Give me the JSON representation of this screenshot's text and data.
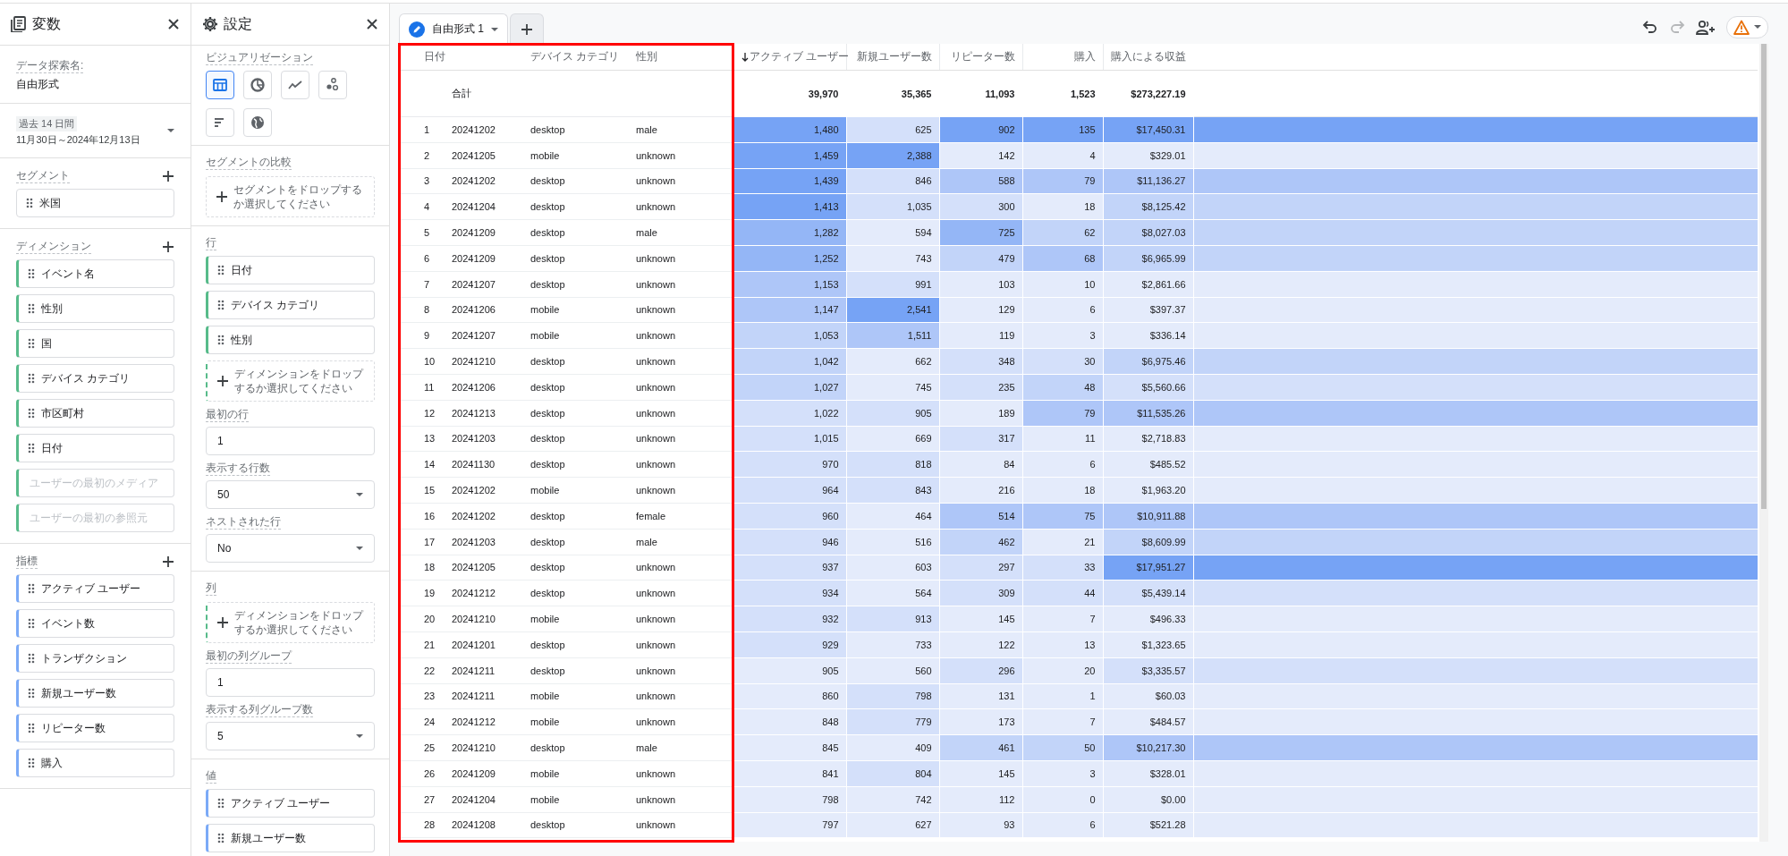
{
  "variables_panel": {
    "title": "変数",
    "exploration_label": "データ探索名:",
    "exploration_name": "自由形式",
    "date_range": {
      "badge": "過去 14 日間",
      "range": "11月30日～2024年12月13日"
    },
    "segments": {
      "label": "セグメント",
      "items": [
        {
          "label": "米国",
          "disabled": false
        }
      ]
    },
    "dimensions": {
      "label": "ディメンション",
      "items": [
        {
          "label": "イベント名",
          "disabled": false
        },
        {
          "label": "性別",
          "disabled": false
        },
        {
          "label": "国",
          "disabled": false
        },
        {
          "label": "デバイス カテゴリ",
          "disabled": false
        },
        {
          "label": "市区町村",
          "disabled": false
        },
        {
          "label": "日付",
          "disabled": false
        },
        {
          "label": "ユーザーの最初のメディア",
          "disabled": true
        },
        {
          "label": "ユーザーの最初の参照元",
          "disabled": true
        }
      ]
    },
    "metrics": {
      "label": "指標",
      "items": [
        {
          "label": "アクティブ ユーザー",
          "disabled": false
        },
        {
          "label": "イベント数",
          "disabled": false
        },
        {
          "label": "トランザクション",
          "disabled": false
        },
        {
          "label": "新規ユーザー数",
          "disabled": false
        },
        {
          "label": "リピーター数",
          "disabled": false
        },
        {
          "label": "購入",
          "disabled": false
        }
      ]
    }
  },
  "settings_panel": {
    "title": "設定",
    "visualization_label": "ビジュアリゼーション",
    "visualizations": [
      {
        "kind": "table",
        "selected": true
      },
      {
        "kind": "donut",
        "selected": false
      },
      {
        "kind": "line",
        "selected": false
      },
      {
        "kind": "scatter",
        "selected": false
      },
      {
        "kind": "bar",
        "selected": false
      },
      {
        "kind": "map",
        "selected": false
      }
    ],
    "segment_compare": {
      "label": "セグメントの比較",
      "drop_hint": "セグメントをドロップするか選択してください"
    },
    "rows": {
      "label": "行",
      "items": [
        {
          "label": "日付",
          "disabled": false
        },
        {
          "label": "デバイス カテゴリ",
          "disabled": false
        },
        {
          "label": "性別",
          "disabled": false
        }
      ],
      "drop_hint": "ディメンションをドロップするか選択してください"
    },
    "row_fields": [
      {
        "label": "最初の行",
        "kind": "input",
        "value": "1"
      },
      {
        "label": "表示する行数",
        "kind": "select",
        "value": "50"
      },
      {
        "label": "ネストされた行",
        "kind": "select",
        "value": "No"
      }
    ],
    "columns": {
      "label": "列",
      "drop_hint": "ディメンションをドロップするか選択してください"
    },
    "column_fields": [
      {
        "label": "最初の列グループ",
        "kind": "input",
        "value": "1"
      },
      {
        "label": "表示する列グループ数",
        "kind": "select",
        "value": "5"
      }
    ],
    "values": {
      "label": "値",
      "items": [
        {
          "label": "アクティブ ユーザー",
          "disabled": false
        },
        {
          "label": "新規ユーザー数",
          "disabled": false
        }
      ]
    }
  },
  "tabs": [
    {
      "label": "自由形式 1",
      "selected": true
    }
  ],
  "toolbar": [
    {
      "kind": "undo",
      "disabled": false
    },
    {
      "kind": "redo",
      "disabled": true
    },
    {
      "kind": "share",
      "disabled": false
    },
    {
      "kind": "warning",
      "disabled": false
    }
  ],
  "table": {
    "columns": [
      {
        "label": "日付",
        "kind": "dimension",
        "sorted": false
      },
      {
        "label": "デバイス カテゴリ",
        "kind": "dimension",
        "sorted": false
      },
      {
        "label": "性別",
        "kind": "dimension",
        "sorted": false
      },
      {
        "label": "アクティブ ユーザー",
        "kind": "metric",
        "sorted": true
      },
      {
        "label": "新規ユーザー数",
        "kind": "metric",
        "sorted": false
      },
      {
        "label": "リピーター数",
        "kind": "metric",
        "sorted": false
      },
      {
        "label": "購入",
        "kind": "metric",
        "sorted": false
      },
      {
        "label": "購入による収益",
        "kind": "metric",
        "sorted": false
      }
    ],
    "totals": {
      "label": "合計",
      "values": [
        "39,970",
        "35,365",
        "11,093",
        "1,523",
        "$273,227.19"
      ]
    },
    "rows": [
      {
        "index": "1",
        "cells": [
          "20241202",
          "desktop",
          "male"
        ],
        "metrics": [
          {
            "text": "1,480",
            "color": "#76a3f5"
          },
          {
            "text": "625",
            "color": "#d4e0fa"
          },
          {
            "text": "902",
            "color": "#76a3f5"
          },
          {
            "text": "135",
            "color": "#76a3f5"
          },
          {
            "text": "$17,450.31",
            "color": "#76a3f5"
          }
        ]
      },
      {
        "index": "2",
        "cells": [
          "20241205",
          "mobile",
          "unknown"
        ],
        "metrics": [
          {
            "text": "1,459",
            "color": "#76a3f5"
          },
          {
            "text": "2,388",
            "color": "#76a3f5"
          },
          {
            "text": "142",
            "color": "#e4ebfb"
          },
          {
            "text": "4",
            "color": "#e4ebfb"
          },
          {
            "text": "$329.01",
            "color": "#e4ebfb"
          }
        ]
      },
      {
        "index": "3",
        "cells": [
          "20241202",
          "desktop",
          "unknown"
        ],
        "metrics": [
          {
            "text": "1,439",
            "color": "#76a3f5"
          },
          {
            "text": "846",
            "color": "#d4e0fa"
          },
          {
            "text": "588",
            "color": "#aec6f8"
          },
          {
            "text": "79",
            "color": "#aec6f8"
          },
          {
            "text": "$11,136.27",
            "color": "#aec6f8"
          }
        ]
      },
      {
        "index": "4",
        "cells": [
          "20241204",
          "desktop",
          "unknown"
        ],
        "metrics": [
          {
            "text": "1,413",
            "color": "#76a3f5"
          },
          {
            "text": "1,035",
            "color": "#d4e0fa"
          },
          {
            "text": "300",
            "color": "#d4e0fa"
          },
          {
            "text": "18",
            "color": "#e4ebfb"
          },
          {
            "text": "$8,125.42",
            "color": "#c2d4f9"
          }
        ]
      },
      {
        "index": "5",
        "cells": [
          "20241209",
          "desktop",
          "male"
        ],
        "metrics": [
          {
            "text": "1,282",
            "color": "#94b6f6"
          },
          {
            "text": "594",
            "color": "#e4ebfb"
          },
          {
            "text": "725",
            "color": "#94b6f6"
          },
          {
            "text": "62",
            "color": "#c2d4f9"
          },
          {
            "text": "$8,027.03",
            "color": "#c2d4f9"
          }
        ]
      },
      {
        "index": "6",
        "cells": [
          "20241209",
          "desktop",
          "unknown"
        ],
        "metrics": [
          {
            "text": "1,252",
            "color": "#94b6f6"
          },
          {
            "text": "743",
            "color": "#e4ebfb"
          },
          {
            "text": "479",
            "color": "#c2d4f9"
          },
          {
            "text": "68",
            "color": "#aec6f8"
          },
          {
            "text": "$6,965.99",
            "color": "#c2d4f9"
          }
        ]
      },
      {
        "index": "7",
        "cells": [
          "20241207",
          "desktop",
          "unknown"
        ],
        "metrics": [
          {
            "text": "1,153",
            "color": "#aec6f8"
          },
          {
            "text": "991",
            "color": "#d4e0fa"
          },
          {
            "text": "103",
            "color": "#e4ebfb"
          },
          {
            "text": "10",
            "color": "#e4ebfb"
          },
          {
            "text": "$2,861.66",
            "color": "#e4ebfb"
          }
        ]
      },
      {
        "index": "8",
        "cells": [
          "20241206",
          "mobile",
          "unknown"
        ],
        "metrics": [
          {
            "text": "1,147",
            "color": "#aec6f8"
          },
          {
            "text": "2,541",
            "color": "#76a3f5"
          },
          {
            "text": "129",
            "color": "#e4ebfb"
          },
          {
            "text": "6",
            "color": "#e4ebfb"
          },
          {
            "text": "$397.37",
            "color": "#e4ebfb"
          }
        ]
      },
      {
        "index": "9",
        "cells": [
          "20241207",
          "mobile",
          "unknown"
        ],
        "metrics": [
          {
            "text": "1,053",
            "color": "#c2d4f9"
          },
          {
            "text": "1,511",
            "color": "#aec6f8"
          },
          {
            "text": "119",
            "color": "#e4ebfb"
          },
          {
            "text": "3",
            "color": "#e4ebfb"
          },
          {
            "text": "$336.14",
            "color": "#e4ebfb"
          }
        ]
      },
      {
        "index": "10",
        "cells": [
          "20241210",
          "desktop",
          "unknown"
        ],
        "metrics": [
          {
            "text": "1,042",
            "color": "#c2d4f9"
          },
          {
            "text": "662",
            "color": "#e4ebfb"
          },
          {
            "text": "348",
            "color": "#d4e0fa"
          },
          {
            "text": "30",
            "color": "#d4e0fa"
          },
          {
            "text": "$6,975.46",
            "color": "#c2d4f9"
          }
        ]
      },
      {
        "index": "11",
        "cells": [
          "20241206",
          "desktop",
          "unknown"
        ],
        "metrics": [
          {
            "text": "1,027",
            "color": "#c2d4f9"
          },
          {
            "text": "745",
            "color": "#e4ebfb"
          },
          {
            "text": "235",
            "color": "#d4e0fa"
          },
          {
            "text": "48",
            "color": "#c2d4f9"
          },
          {
            "text": "$5,560.66",
            "color": "#d4e0fa"
          }
        ]
      },
      {
        "index": "12",
        "cells": [
          "20241213",
          "desktop",
          "unknown"
        ],
        "metrics": [
          {
            "text": "1,022",
            "color": "#d4e0fa"
          },
          {
            "text": "905",
            "color": "#d4e0fa"
          },
          {
            "text": "189",
            "color": "#e4ebfb"
          },
          {
            "text": "79",
            "color": "#aec6f8"
          },
          {
            "text": "$11,535.26",
            "color": "#aec6f8"
          }
        ]
      },
      {
        "index": "13",
        "cells": [
          "20241203",
          "desktop",
          "unknown"
        ],
        "metrics": [
          {
            "text": "1,015",
            "color": "#d4e0fa"
          },
          {
            "text": "669",
            "color": "#e4ebfb"
          },
          {
            "text": "317",
            "color": "#d4e0fa"
          },
          {
            "text": "11",
            "color": "#e4ebfb"
          },
          {
            "text": "$2,718.83",
            "color": "#e4ebfb"
          }
        ]
      },
      {
        "index": "14",
        "cells": [
          "20241130",
          "desktop",
          "unknown"
        ],
        "metrics": [
          {
            "text": "970",
            "color": "#d4e0fa"
          },
          {
            "text": "818",
            "color": "#d4e0fa"
          },
          {
            "text": "84",
            "color": "#e4ebfb"
          },
          {
            "text": "6",
            "color": "#e4ebfb"
          },
          {
            "text": "$485.52",
            "color": "#e4ebfb"
          }
        ]
      },
      {
        "index": "15",
        "cells": [
          "20241202",
          "mobile",
          "unknown"
        ],
        "metrics": [
          {
            "text": "964",
            "color": "#d4e0fa"
          },
          {
            "text": "843",
            "color": "#d4e0fa"
          },
          {
            "text": "216",
            "color": "#e4ebfb"
          },
          {
            "text": "18",
            "color": "#e4ebfb"
          },
          {
            "text": "$1,963.20",
            "color": "#e4ebfb"
          }
        ]
      },
      {
        "index": "16",
        "cells": [
          "20241202",
          "desktop",
          "female"
        ],
        "metrics": [
          {
            "text": "960",
            "color": "#d4e0fa"
          },
          {
            "text": "464",
            "color": "#e4ebfb"
          },
          {
            "text": "514",
            "color": "#aec6f8"
          },
          {
            "text": "75",
            "color": "#aec6f8"
          },
          {
            "text": "$10,911.88",
            "color": "#aec6f8"
          }
        ]
      },
      {
        "index": "17",
        "cells": [
          "20241203",
          "desktop",
          "male"
        ],
        "metrics": [
          {
            "text": "946",
            "color": "#d4e0fa"
          },
          {
            "text": "516",
            "color": "#e4ebfb"
          },
          {
            "text": "462",
            "color": "#c2d4f9"
          },
          {
            "text": "21",
            "color": "#e4ebfb"
          },
          {
            "text": "$8,609.99",
            "color": "#c2d4f9"
          }
        ]
      },
      {
        "index": "18",
        "cells": [
          "20241205",
          "desktop",
          "unknown"
        ],
        "metrics": [
          {
            "text": "937",
            "color": "#d4e0fa"
          },
          {
            "text": "603",
            "color": "#e4ebfb"
          },
          {
            "text": "297",
            "color": "#d4e0fa"
          },
          {
            "text": "33",
            "color": "#d4e0fa"
          },
          {
            "text": "$17,951.27",
            "color": "#76a3f5"
          }
        ]
      },
      {
        "index": "19",
        "cells": [
          "20241212",
          "desktop",
          "unknown"
        ],
        "metrics": [
          {
            "text": "934",
            "color": "#d4e0fa"
          },
          {
            "text": "564",
            "color": "#e4ebfb"
          },
          {
            "text": "309",
            "color": "#d4e0fa"
          },
          {
            "text": "44",
            "color": "#d4e0fa"
          },
          {
            "text": "$5,439.14",
            "color": "#d4e0fa"
          }
        ]
      },
      {
        "index": "20",
        "cells": [
          "20241210",
          "mobile",
          "unknown"
        ],
        "metrics": [
          {
            "text": "932",
            "color": "#d4e0fa"
          },
          {
            "text": "913",
            "color": "#d4e0fa"
          },
          {
            "text": "145",
            "color": "#e4ebfb"
          },
          {
            "text": "7",
            "color": "#e4ebfb"
          },
          {
            "text": "$496.33",
            "color": "#e4ebfb"
          }
        ]
      },
      {
        "index": "21",
        "cells": [
          "20241201",
          "desktop",
          "unknown"
        ],
        "metrics": [
          {
            "text": "929",
            "color": "#d4e0fa"
          },
          {
            "text": "733",
            "color": "#e4ebfb"
          },
          {
            "text": "122",
            "color": "#e4ebfb"
          },
          {
            "text": "13",
            "color": "#e4ebfb"
          },
          {
            "text": "$1,323.65",
            "color": "#e4ebfb"
          }
        ]
      },
      {
        "index": "22",
        "cells": [
          "20241211",
          "desktop",
          "unknown"
        ],
        "metrics": [
          {
            "text": "905",
            "color": "#e4ebfb"
          },
          {
            "text": "560",
            "color": "#e4ebfb"
          },
          {
            "text": "296",
            "color": "#d4e0fa"
          },
          {
            "text": "20",
            "color": "#e4ebfb"
          },
          {
            "text": "$3,335.57",
            "color": "#d4e0fa"
          }
        ]
      },
      {
        "index": "23",
        "cells": [
          "20241211",
          "mobile",
          "unknown"
        ],
        "metrics": [
          {
            "text": "860",
            "color": "#e4ebfb"
          },
          {
            "text": "798",
            "color": "#d4e0fa"
          },
          {
            "text": "131",
            "color": "#e4ebfb"
          },
          {
            "text": "1",
            "color": "#e4ebfb"
          },
          {
            "text": "$60.03",
            "color": "#e4ebfb"
          }
        ]
      },
      {
        "index": "24",
        "cells": [
          "20241212",
          "mobile",
          "unknown"
        ],
        "metrics": [
          {
            "text": "848",
            "color": "#e4ebfb"
          },
          {
            "text": "779",
            "color": "#d4e0fa"
          },
          {
            "text": "173",
            "color": "#e4ebfb"
          },
          {
            "text": "7",
            "color": "#e4ebfb"
          },
          {
            "text": "$484.57",
            "color": "#e4ebfb"
          }
        ]
      },
      {
        "index": "25",
        "cells": [
          "20241210",
          "desktop",
          "male"
        ],
        "metrics": [
          {
            "text": "845",
            "color": "#e4ebfb"
          },
          {
            "text": "409",
            "color": "#e4ebfb"
          },
          {
            "text": "461",
            "color": "#c2d4f9"
          },
          {
            "text": "50",
            "color": "#c2d4f9"
          },
          {
            "text": "$10,217.30",
            "color": "#aec6f8"
          }
        ]
      },
      {
        "index": "26",
        "cells": [
          "20241209",
          "mobile",
          "unknown"
        ],
        "metrics": [
          {
            "text": "841",
            "color": "#e4ebfb"
          },
          {
            "text": "804",
            "color": "#d4e0fa"
          },
          {
            "text": "145",
            "color": "#e4ebfb"
          },
          {
            "text": "3",
            "color": "#e4ebfb"
          },
          {
            "text": "$328.01",
            "color": "#e4ebfb"
          }
        ]
      },
      {
        "index": "27",
        "cells": [
          "20241204",
          "mobile",
          "unknown"
        ],
        "metrics": [
          {
            "text": "798",
            "color": "#e4ebfb"
          },
          {
            "text": "742",
            "color": "#e4ebfb"
          },
          {
            "text": "112",
            "color": "#e4ebfb"
          },
          {
            "text": "0",
            "color": "#e4ebfb"
          },
          {
            "text": "$0.00",
            "color": "#e4ebfb"
          }
        ]
      },
      {
        "index": "28",
        "cells": [
          "20241208",
          "desktop",
          "unknown"
        ],
        "metrics": [
          {
            "text": "797",
            "color": "#e4ebfb"
          },
          {
            "text": "627",
            "color": "#e4ebfb"
          },
          {
            "text": "93",
            "color": "#e4ebfb"
          },
          {
            "text": "6",
            "color": "#e4ebfb"
          },
          {
            "text": "$521.28",
            "color": "#e4ebfb"
          }
        ]
      }
    ]
  },
  "annotation": {
    "kind": "highlight-frame"
  }
}
